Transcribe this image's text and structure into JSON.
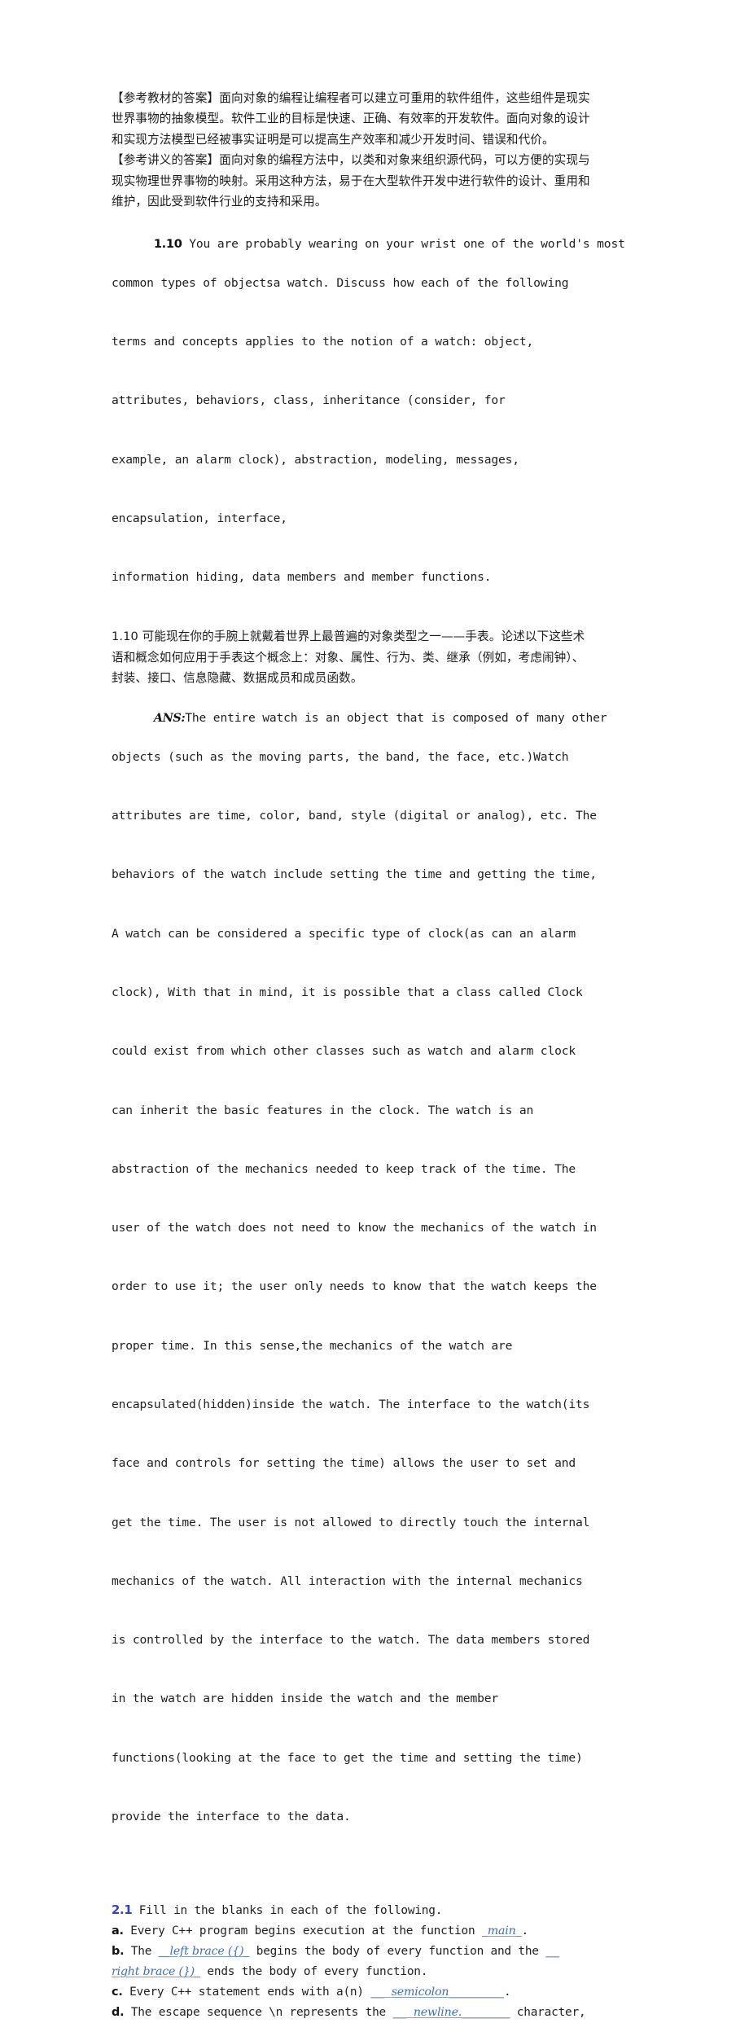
{
  "document": {
    "page_background": "#ffffff",
    "text_color": "#1f1f1f",
    "accent_blue": "#3f6fc4",
    "heading_blue": "#2b43c9"
  },
  "blocks": {
    "ref_textbook_answer": {
      "label": "【参考教材的答案】",
      "line1": "【参考教材的答案】面向对象的编程让编程者可以建立可重用的软件组件，这些组件是现实",
      "line2": "世界事物的抽象模型。软件工业的目标是快速、正确、有效率的开发软件。面向对象的设计",
      "line3": "和实现方法模型已经被事实证明是可以提高生产效率和减少开发时间、错误和代价。"
    },
    "ref_lecture_answer": {
      "label": "【参考讲义的答案】",
      "line1": "【参考讲义的答案】面向对象的编程方法中，以类和对象来组织源代码，可以方便的实现与",
      "line2": "现实物理世界事物的映射。采用这种方法，易于在大型软件开发中进行软件的设计、重用和",
      "line3": "维护，因此受到软件行业的支持和采用。"
    },
    "question_1_10": {
      "number": "1.10",
      "lines": [
        " You are probably wearing on your wrist one of the world's most",
        "common types of objectsa watch. Discuss how each of the following",
        "terms and concepts applies to the notion of a watch: object,",
        "attributes, behaviors, class, inheritance (consider, for",
        "example, an alarm clock), abstraction, modeling, messages,",
        "encapsulation, interface,",
        "information hiding, data members and member functions."
      ]
    },
    "question_1_10_cn": {
      "number": "1.10",
      "line1": "1.10 可能现在你的手腕上就戴着世界上最普遍的对象类型之一——手表。论述以下这些术",
      "line2": "语和概念如何应用于手表这个概念上：对象、属性、行为、类、继承（例如，考虑闹钟）、",
      "line3": "封装、接口、信息隐藏、数据成员和成员函数。"
    },
    "answer_1_10": {
      "tag": "ANS:",
      "lines": [
        "The entire watch is an object that is composed of many other",
        "objects (such as the moving parts, the band, the face, etc.)Watch",
        "attributes are time, color, band, style (digital or analog), etc. The",
        "behaviors of the watch include setting the time and getting the time,",
        "A watch can be considered a specific type of clock(as can an alarm",
        "clock), With that in mind, it is possible that a class called Clock",
        "could exist from which other classes such as watch and alarm clock",
        "can inherit the basic features in the clock. The watch is an",
        "abstraction of the mechanics needed to keep track of the time. The",
        "user of the watch does not need to know the mechanics of the watch in",
        "order to use it; the user only needs to know that the watch keeps the",
        "proper time. In this sense,the mechanics of the watch are",
        "encapsulated(hidden)inside the watch. The interface to the watch(its",
        "face and controls for setting the time) allows the user to set and",
        "get the time. The user is not allowed to directly touch the internal",
        "mechanics of the watch. All interaction with the internal mechanics",
        "is controlled by the interface to the watch. The data members stored",
        "in the watch are hidden inside the watch and the member",
        "functions(looking at the face to get the time and setting the time)",
        "provide the interface to the data."
      ]
    },
    "question_2_1": {
      "number": "2.1",
      "prompt": " Fill in the blanks in each of the following.",
      "items": [
        {
          "letter": "a.",
          "pre": " Every C++ program begins execution at the function ",
          "blank": "_main_",
          "post": "."
        },
        {
          "letter": "b.",
          "pre": " The ",
          "blank": "__left brace ({)_",
          "mid": " begins the body of every function and the ",
          "rule1": "__",
          "blank2": "right brace (})_",
          "post": " ends the body of every function."
        },
        {
          "letter": "c.",
          "pre": " Every C++ statement ends with a(n) ",
          "rule1": "__ ",
          "blank": "semicolon",
          "rule2": "________",
          "post": "."
        },
        {
          "letter": "d.",
          "pre": " The escape sequence \\n represents the ",
          "rule1": "__ ",
          "blank": "newline.",
          "rule2": "_______",
          "post": " character,"
        }
      ]
    }
  }
}
